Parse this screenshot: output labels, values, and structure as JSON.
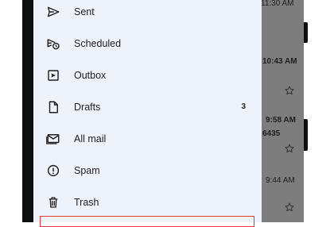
{
  "drawer": {
    "items": [
      {
        "id": "sent",
        "label": "Sent",
        "icon": "send-icon"
      },
      {
        "id": "scheduled",
        "label": "Scheduled",
        "icon": "scheduled-send-icon"
      },
      {
        "id": "outbox",
        "label": "Outbox",
        "icon": "outbox-icon"
      },
      {
        "id": "drafts",
        "label": "Drafts",
        "icon": "draft-icon",
        "count": "3"
      },
      {
        "id": "all-mail",
        "label": "All mail",
        "icon": "all-mail-icon"
      },
      {
        "id": "spam",
        "label": "Spam",
        "icon": "spam-icon"
      },
      {
        "id": "trash",
        "label": "Trash",
        "icon": "trash-icon"
      }
    ]
  },
  "background_inbox": {
    "times": [
      "11:30 AM",
      "10:43 AM",
      "9:58 AM",
      "9:44 AM"
    ],
    "snippet_fragment": "6435"
  },
  "colors": {
    "drawer_bg": "#eef2fb",
    "scrim": "#7d7d7d",
    "highlight_border": "#e53935",
    "text": "#1f1f1f"
  }
}
